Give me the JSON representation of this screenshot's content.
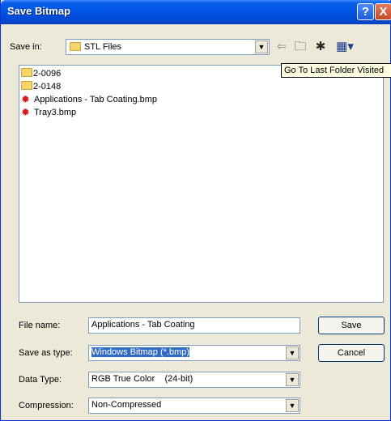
{
  "window": {
    "title": "Save Bitmap",
    "help_glyph": "?",
    "close_glyph": "X"
  },
  "toolbar": {
    "save_in_label": "Save in:",
    "save_in_value": "STL Files",
    "back_icon": "back-arrow-icon",
    "up_icon": "up-folder-icon",
    "new_folder_icon": "new-folder-icon",
    "views_icon": "views-menu-icon"
  },
  "tooltip": {
    "text": "Go To Last Folder Visited"
  },
  "files": [
    {
      "name": "2-0096",
      "type": "folder"
    },
    {
      "name": "2-0148",
      "type": "folder"
    },
    {
      "name": "Applications - Tab Coating.bmp",
      "type": "bmp"
    },
    {
      "name": "Tray3.bmp",
      "type": "bmp"
    }
  ],
  "form": {
    "file_name_label": "File name:",
    "file_name_value": "Applications - Tab Coating",
    "save_as_type_label": "Save as type:",
    "save_as_type_value": "Windows Bitmap (*.bmp)",
    "data_type_label": "Data Type:",
    "data_type_value": "RGB True Color    (24-bit)",
    "compression_label": "Compression:",
    "compression_value": "Non-Compressed"
  },
  "buttons": {
    "save": "Save",
    "cancel": "Cancel"
  },
  "colors": {
    "title_bar": "#0054e3",
    "dialog_bg": "#ece9d8",
    "selection": "#316ac5",
    "tooltip_bg": "#ffffe1"
  }
}
